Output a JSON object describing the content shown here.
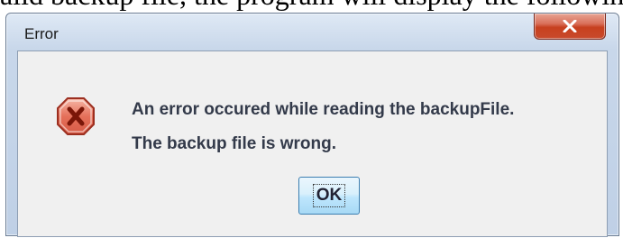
{
  "document": {
    "fragment_text": "alid backup file, the program will display the following"
  },
  "dialog": {
    "title": "Error",
    "close_icon": "close-x-icon",
    "error_icon": "error-octagon-icon",
    "message_lines": [
      "An error occured while reading the backupFile.",
      "The backup file is wrong."
    ],
    "ok_label": "OK"
  },
  "colors": {
    "close_button_red": "#c7401f",
    "error_icon_red": "#c0392b",
    "ok_button_blue": "#bee6fd"
  }
}
